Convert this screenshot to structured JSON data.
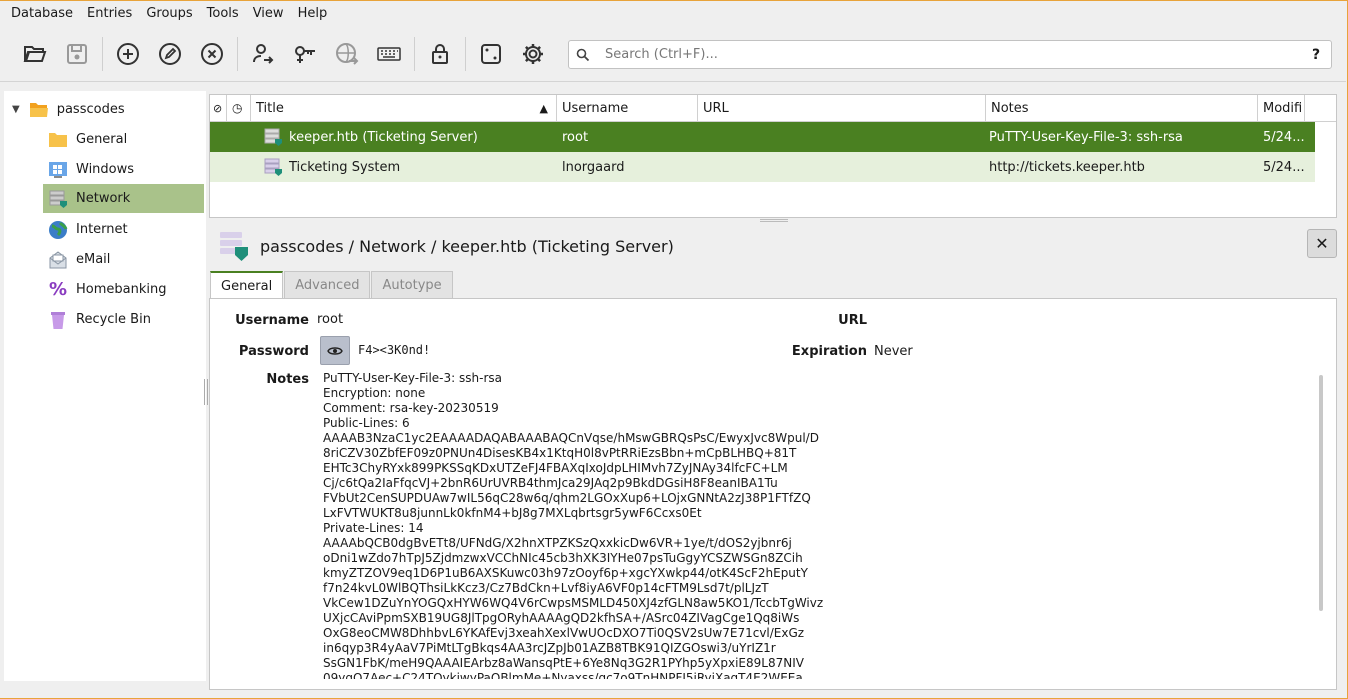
{
  "menu": [
    "Database",
    "Entries",
    "Groups",
    "Tools",
    "View",
    "Help"
  ],
  "toolbar": {
    "buttons": [
      "open-database",
      "save-database",
      "add-entry",
      "edit-entry",
      "delete-entry",
      "transfer-user",
      "copy-password",
      "open-url",
      "autotype-keyboard",
      "lock-database",
      "password-generator",
      "settings"
    ]
  },
  "search": {
    "placeholder": "Search (Ctrl+F)...",
    "help": "?"
  },
  "sidebar": {
    "root": "passcodes",
    "groups": [
      {
        "label": "General",
        "icon": "folder-icon"
      },
      {
        "label": "Windows",
        "icon": "windows-icon"
      },
      {
        "label": "Network",
        "icon": "server-icon",
        "selected": true
      },
      {
        "label": "Internet",
        "icon": "globe-icon"
      },
      {
        "label": "eMail",
        "icon": "mail-icon"
      },
      {
        "label": "Homebanking",
        "icon": "percent-icon"
      },
      {
        "label": "Recycle Bin",
        "icon": "trash-icon"
      }
    ]
  },
  "table": {
    "columns": [
      "Title",
      "Username",
      "URL",
      "Notes",
      "Modifi"
    ],
    "rows": [
      {
        "title": "keeper.htb (Ticketing Server)",
        "username": "root",
        "url": "",
        "notes": "PuTTY-User-Key-File-3: ssh-rsa",
        "modified": "5/24..."
      },
      {
        "title": "Ticketing System",
        "username": "lnorgaard",
        "url": "",
        "notes": "http://tickets.keeper.htb",
        "modified": "5/24..."
      }
    ]
  },
  "detail": {
    "title": "passcodes / Network / keeper.htb (Ticketing Server)",
    "close": "✕",
    "tabs": [
      "General",
      "Advanced",
      "Autotype"
    ],
    "username_label": "Username",
    "username": "root",
    "password_label": "Password",
    "password": "F4><3K0nd!",
    "url_label": "URL",
    "expiration_label": "Expiration",
    "expiration": "Never",
    "notes_label": "Notes",
    "notes": "PuTTY-User-Key-File-3: ssh-rsa\nEncryption: none\nComment: rsa-key-20230519\nPublic-Lines: 6\nAAAAB3NzaC1yc2EAAAADAQABAAABAQCnVqse/hMswGBRQsPsC/EwyxJvc8Wpul/D\n8riCZV30ZbfEF09z0PNUn4DisesKB4x1KtqH0l8vPtRRiEzsBbn+mCpBLHBQ+81T\nEHTc3ChyRYxk899PKSSqKDxUTZeFJ4FBAXqIxoJdpLHIMvh7ZyJNAy34lfcFC+LM\nCj/c6tQa2IaFfqcVJ+2bnR6UrUVRB4thmJca29JAq2p9BkdDGsiH8F8eanIBA1Tu\nFVbUt2CenSUPDUAw7wIL56qC28w6q/qhm2LGOxXup6+LOjxGNNtA2zJ38P1FTfZQ\nLxFVTWUKT8u8junnLk0kfnM4+bJ8g7MXLqbrtsgr5ywF6Ccxs0Et\nPrivate-Lines: 14\nAAAAbQCB0dgBvETt8/UFNdG/X2hnXTPZKSzQxxkicDw6VR+1ye/t/dOS2yjbnr6j\noDni1wZdo7hTpJ5ZjdmzwxVCChNIc45cb3hXK3IYHe07psTuGgyYCSZWSGn8ZCih\nkmyZTZOV9eq1D6P1uB6AXSKuwc03h97zOoyf6p+xgcYXwkp44/otK4ScF2hEputY\nf7n24kvL0WlBQThsiLkKcz3/Cz7BdCkn+Lvf8iyA6VF0p14cFTM9Lsd7t/plLJzT\nVkCew1DZuYnYOGQxHYW6WQ4V6rCwpsMSMLD450XJ4zfGLN8aw5KO1/TccbTgWivz\nUXjcCAviPpmSXB19UG8JlTpgORyhAAAAgQD2kfhSA+/ASrc04ZIVagCge1Qq8iWs\nOxG8eoCMW8DhhbvL6YKAfEvj3xeahXexlVwUOcDXO7Ti0QSV2sUw7E71cvl/ExGz\nin6qyp3R4yAaV7PiMtLTgBkqs4AA3rcJZpJb01AZB8TBK91QIZGOswi3/uYrIZ1r\nSsGN1FbK/meH9QAAAIEArbz8aWansqPtE+6Ye8Nq3G2R1PYhp5yXpxiE89L87NIV\n09ygQ7Aec+C24TOykiwyPaOBlmMe+Nyaxss/gc7o9TnHNPFJ5iRyiXagT4E2WEEa"
  }
}
